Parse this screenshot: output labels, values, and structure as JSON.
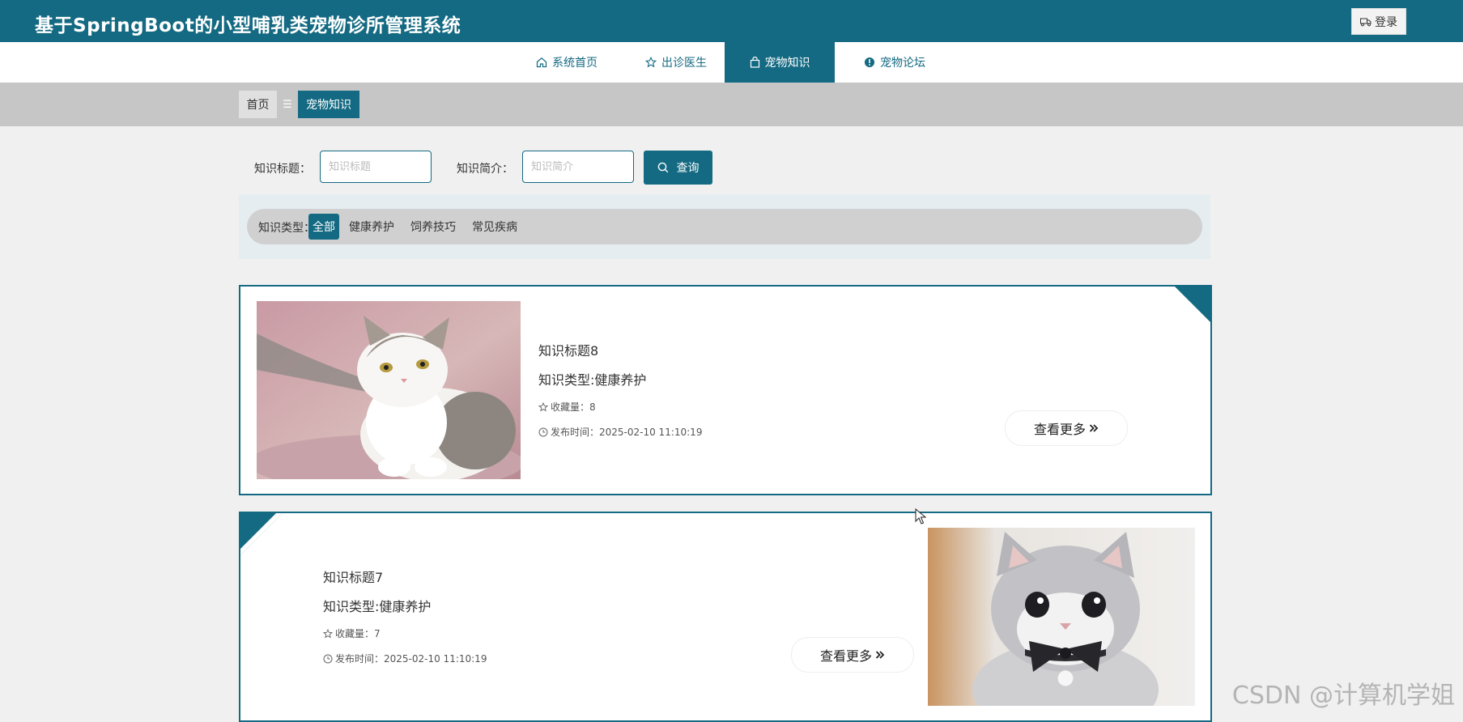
{
  "header": {
    "title": "基于SpringBoot的小型哺乳类宠物诊所管理系统",
    "login_label": "登录"
  },
  "nav": {
    "items": [
      {
        "label": "系统首页",
        "icon": "home-icon"
      },
      {
        "label": "出诊医生",
        "icon": "star-icon"
      },
      {
        "label": "宠物知识",
        "icon": "bag-icon",
        "active": true
      },
      {
        "label": "宠物论坛",
        "icon": "alert-circle-icon"
      }
    ]
  },
  "breadcrumb": {
    "home": "首页",
    "separator": "☰",
    "current": "宠物知识"
  },
  "search": {
    "title_label": "知识标题：",
    "title_placeholder": "知识标题",
    "intro_label": "知识简介：",
    "intro_placeholder": "知识简介",
    "button_label": "查询"
  },
  "filter": {
    "label": "知识类型：",
    "options": [
      "全部",
      "健康养护",
      "饲养技巧",
      "常见疾病"
    ],
    "active": "全部"
  },
  "cards": [
    {
      "title": "知识标题8",
      "type": "知识类型:健康养护",
      "favorites": "收藏量：8",
      "published": "发布时间：2025-02-10 11:10:19",
      "more_label": "查看更多",
      "image": "white-tabby-cat-photo"
    },
    {
      "title": "知识标题7",
      "type": "知识类型:健康养护",
      "favorites": "收藏量：7",
      "published": "发布时间：2025-02-10 11:10:19",
      "more_label": "查看更多",
      "image": "grey-kitten-with-bow-photo"
    }
  ],
  "watermark": "CSDN @计算机学姐",
  "colors": {
    "primary": "#146a82",
    "page_bg": "#f0f0f0",
    "breadcrumb_bg": "#c6c6c6"
  }
}
